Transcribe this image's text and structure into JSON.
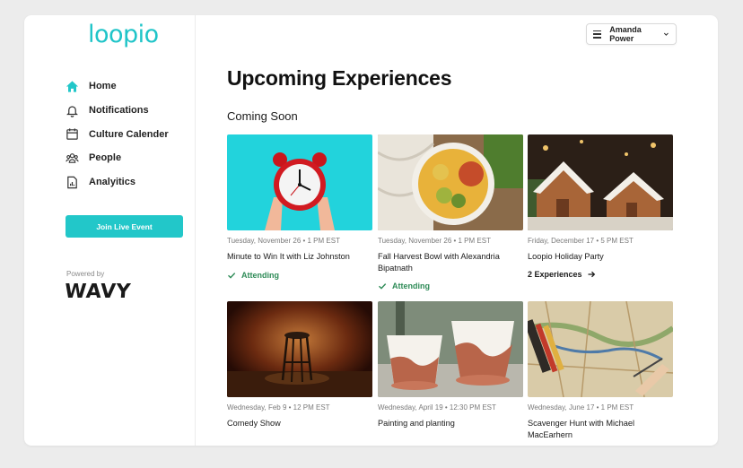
{
  "brand": {
    "logo_text": "loopio",
    "accent": "#22c7c9"
  },
  "sidebar": {
    "items": [
      {
        "label": "Home",
        "icon": "home-icon"
      },
      {
        "label": "Notifications",
        "icon": "bell-icon"
      },
      {
        "label": "Culture Calender",
        "icon": "calendar-icon"
      },
      {
        "label": "People",
        "icon": "people-icon"
      },
      {
        "label": "Analyitics",
        "icon": "analytics-icon"
      }
    ],
    "join_label": "Join Live Event",
    "powered_by": "Powered by",
    "powered_logo": "WAVY"
  },
  "header": {
    "user_name": "Amanda Power"
  },
  "main": {
    "title": "Upcoming Experiences",
    "section_title": "Coming Soon",
    "cards": [
      {
        "date": "Tuesday, November 26 • 1 PM EST",
        "title": "Minute to Win It with Liz Johnston",
        "status": "Attending"
      },
      {
        "date": "Tuesday, November 26 • 1 PM EST",
        "title": "Fall Harvest Bowl with Alexandria Bipatnath",
        "status": "Attending"
      },
      {
        "date": "Friday, December 17 • 5 PM EST",
        "title": "Loopio Holiday Party",
        "link": "2 Experiences"
      },
      {
        "date": "Wednesday, Feb 9 • 12 PM EST",
        "title": "Comedy Show"
      },
      {
        "date": "Wednesday, April 19 • 12:30 PM EST",
        "title": "Painting and planting"
      },
      {
        "date": "Wednesday, June 17 • 1 PM EST",
        "title": "Scavenger Hunt with Michael MacEarhern"
      }
    ]
  }
}
